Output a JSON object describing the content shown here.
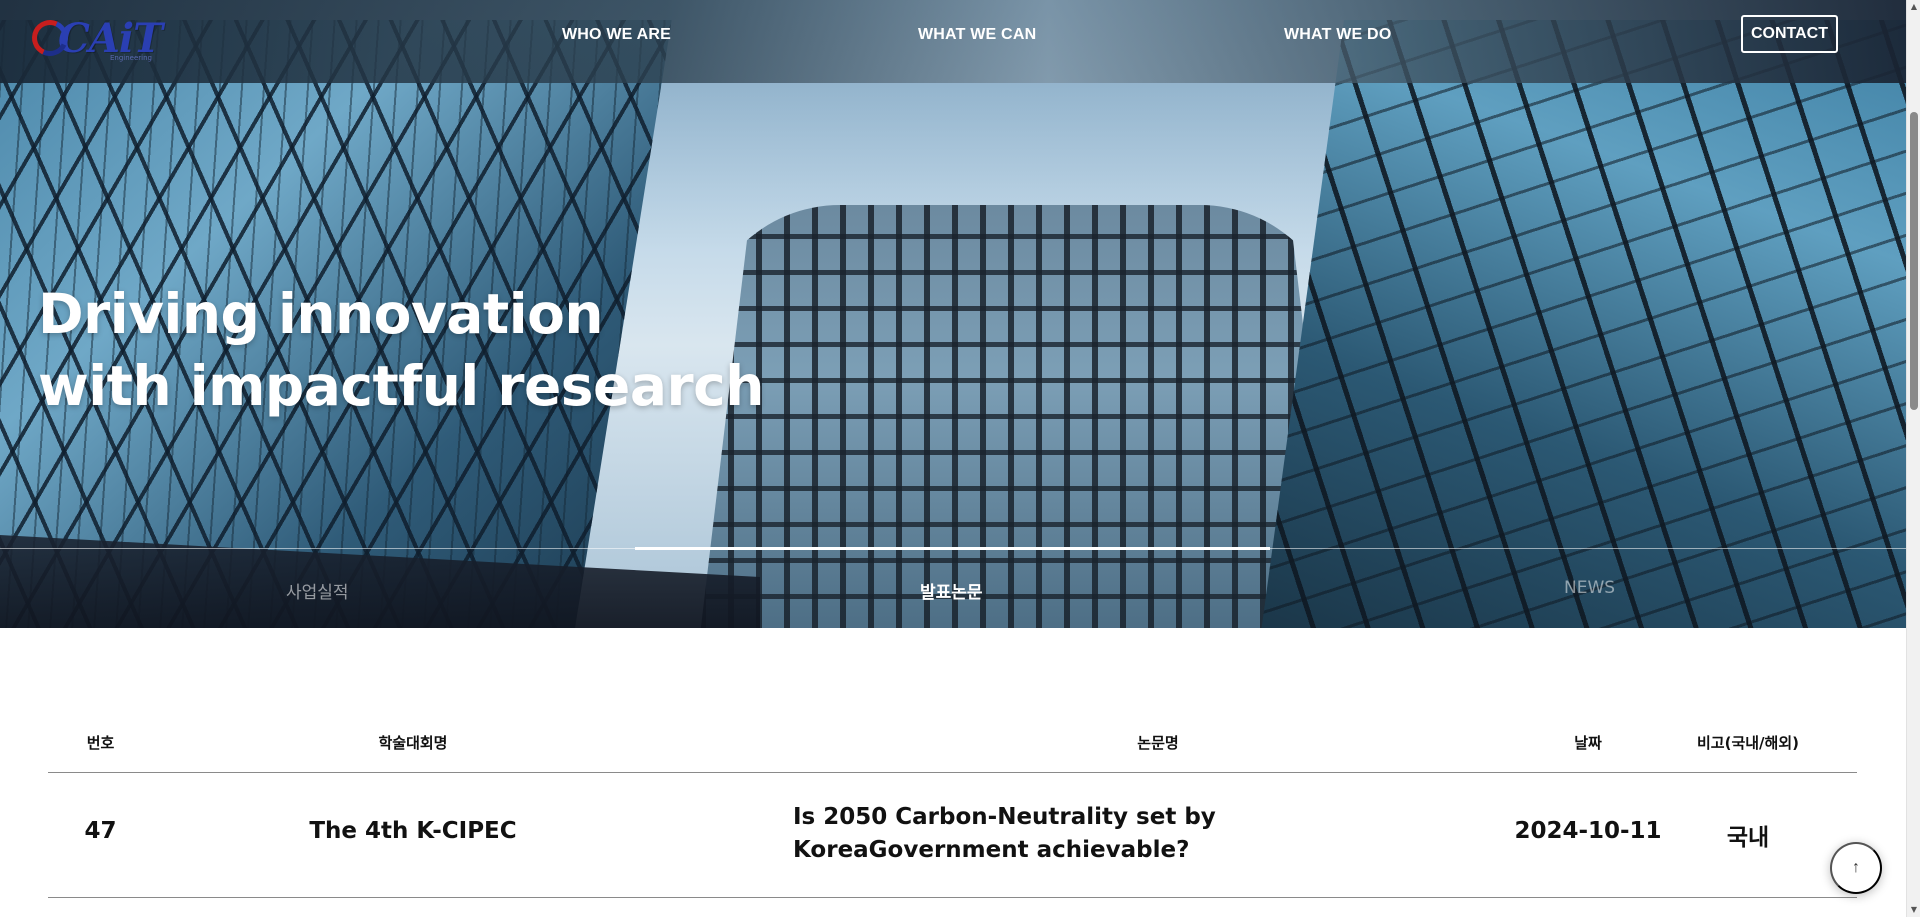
{
  "nav": {
    "logo_text": "CAiT",
    "logo_sub": "Engineering",
    "items": [
      "WHO WE ARE",
      "WHAT WE CAN",
      "WHAT WE DO"
    ],
    "contact_label": "CONTACT"
  },
  "hero": {
    "headline_line1": "Driving innovation",
    "headline_line2": "with impactful research",
    "tabs": [
      "사업실적",
      "발표논문",
      "NEWS"
    ],
    "active_tab": "발표논문"
  },
  "table": {
    "headers": [
      "번호",
      "학술대회명",
      "논문명",
      "날짜",
      "비고(국내/해외)"
    ],
    "rows": [
      {
        "num": "47",
        "conference": "The 4th K-CIPEC",
        "title": "Is 2050 Carbon-Neutrality set by KoreaGovernment achievable?",
        "date": "2024-10-11",
        "note": "국내"
      }
    ]
  },
  "scroll_top": {
    "icon": "arrow-up-icon",
    "glyph": "↑"
  },
  "colors": {
    "nav_text": "#ffffff",
    "table_border": "#8a8a8a",
    "logo_red": "#c81e1e",
    "logo_blue": "#2a3fb3"
  }
}
